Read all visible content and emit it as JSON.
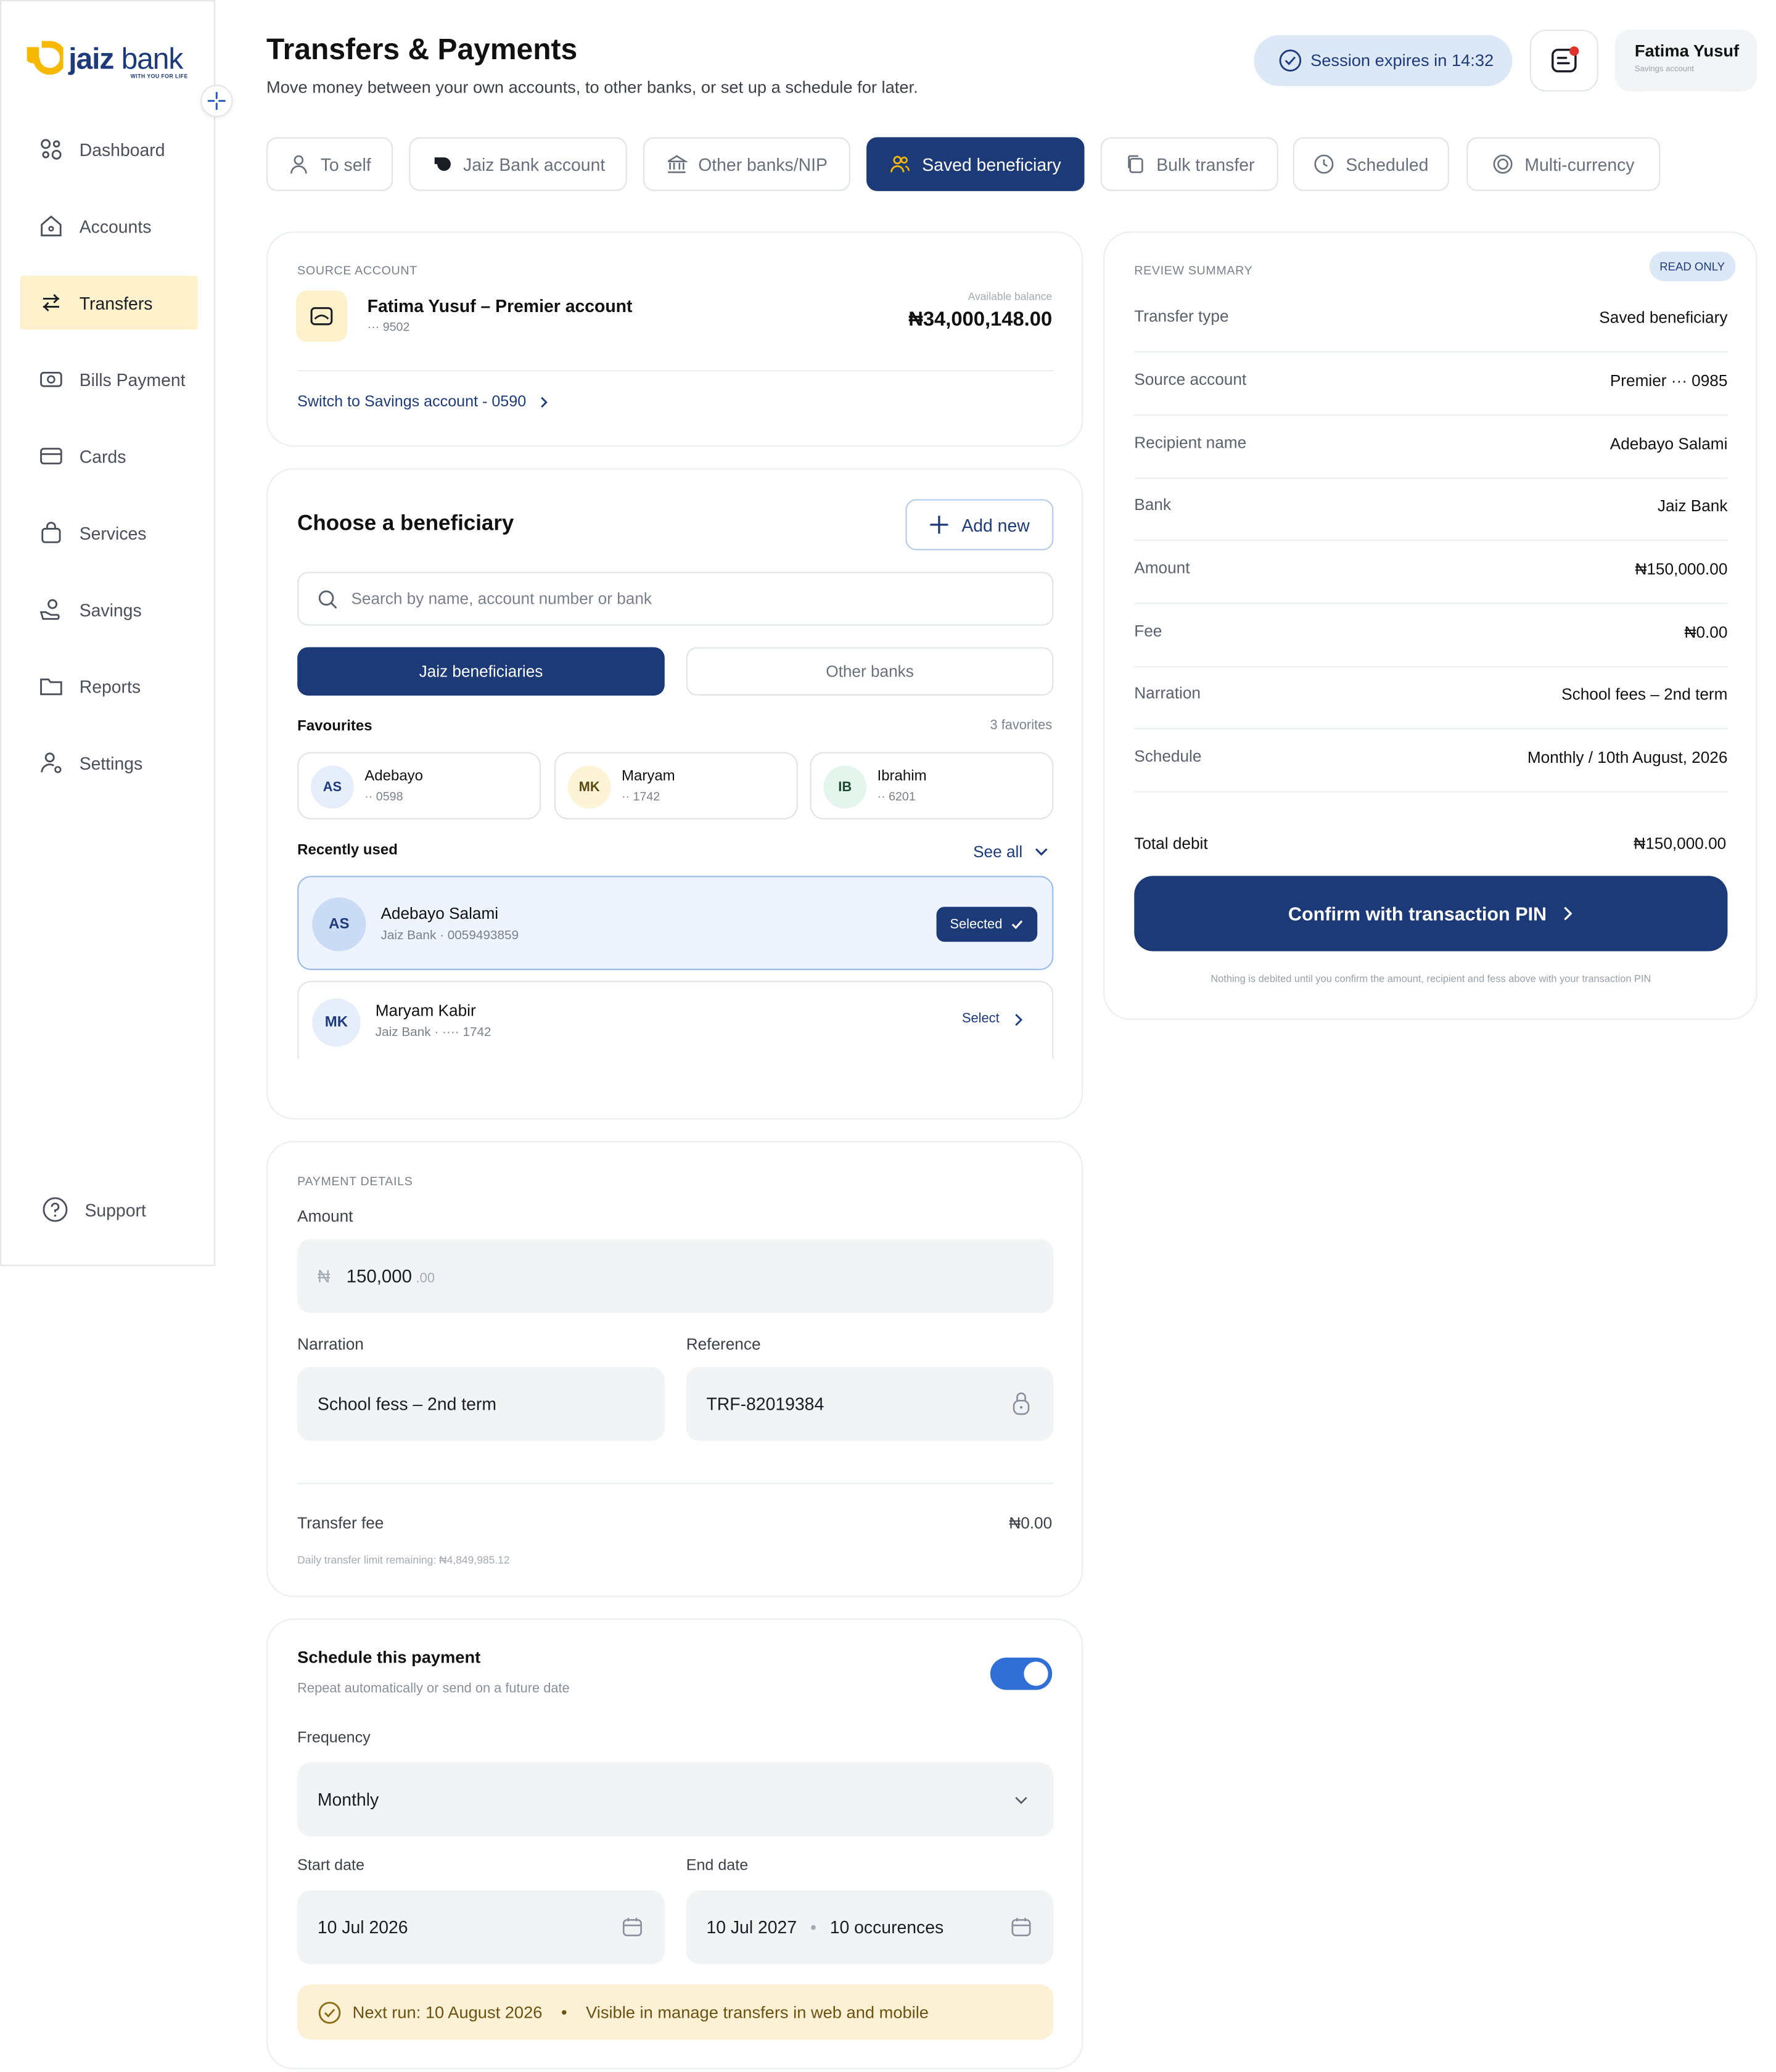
{
  "brand": {
    "name_main": "jaiz",
    "name_rest": "bank",
    "tagline": "WITH YOU FOR LIFE"
  },
  "sidebar": {
    "items": [
      {
        "label": "Dashboard",
        "icon": "dashboard-icon"
      },
      {
        "label": "Accounts",
        "icon": "home-icon"
      },
      {
        "label": "Transfers",
        "icon": "transfer-arrows-icon",
        "active": true
      },
      {
        "label": "Bills Payment",
        "icon": "bills-icon"
      },
      {
        "label": "Cards",
        "icon": "card-icon"
      },
      {
        "label": "Services",
        "icon": "bag-icon"
      },
      {
        "label": "Savings",
        "icon": "savings-icon"
      },
      {
        "label": "Reports",
        "icon": "folder-icon"
      },
      {
        "label": "Settings",
        "icon": "user-settings-icon"
      }
    ],
    "support": "Support"
  },
  "header": {
    "title": "Transfers & Payments",
    "subtitle": "Move money between your own accounts, to other banks, or set up a schedule for later.",
    "session": "Session expires in 14:32",
    "user_name": "Fatima Yusuf",
    "user_account": "Savings account"
  },
  "tabs": [
    {
      "label": "To self",
      "icon": "user-icon"
    },
    {
      "label": "Jaiz Bank account",
      "icon": "jaiz-logo-icon"
    },
    {
      "label": "Other banks/NIP",
      "icon": "bank-icon"
    },
    {
      "label": "Saved beneficiary",
      "icon": "users-icon",
      "active": true
    },
    {
      "label": "Bulk transfer",
      "icon": "copy-icon"
    },
    {
      "label": "Scheduled",
      "icon": "clock-icon"
    },
    {
      "label": "Multi-currency",
      "icon": "currency-icon"
    }
  ],
  "source": {
    "label": "SOURCE ACCOUNT",
    "account_name": "Fatima Yusuf – Premier account",
    "account_mask": "··· 9502",
    "balance_label": "Available balance",
    "balance": "₦34,000,148.00",
    "switch_link": "Switch to Savings account - 0590"
  },
  "beneficiary": {
    "title": "Choose a beneficiary",
    "add_new": "Add new",
    "search_placeholder": "Search by name, account number or bank",
    "seg_jaiz": "Jaiz beneficiaries",
    "seg_other": "Other banks",
    "favourites_label": "Favourites",
    "favourites_count": "3 favorites",
    "favourites": [
      {
        "initials": "AS",
        "name": "Adebayo",
        "acc": "·· 0598",
        "color": "#e6eefb"
      },
      {
        "initials": "MK",
        "name": "Maryam",
        "acc": "·· 1742",
        "color": "#fdf3d6"
      },
      {
        "initials": "IB",
        "name": "Ibrahim",
        "acc": "·· 6201",
        "color": "#e3f5ec"
      }
    ],
    "recent_label": "Recently used",
    "see_all": "See all",
    "recent": [
      {
        "initials": "AS",
        "name": "Adebayo Salami",
        "bank": "Jaiz Bank",
        "acc": "0059493859",
        "action": "Selected"
      },
      {
        "initials": "MK",
        "name": "Maryam Kabir",
        "bank": "Jaiz Bank",
        "acc": "···· 1742",
        "action": "Select"
      }
    ]
  },
  "payment": {
    "label": "PAYMENT DETAILS",
    "amount_label": "Amount",
    "currency_symbol": "₦",
    "amount_value": "150,000",
    "amount_decimal": ".00",
    "narration_label": "Narration",
    "narration_value": "School fess – 2nd term",
    "reference_label": "Reference",
    "reference_value": "TRF-82019384",
    "fee_label": "Transfer fee",
    "fee_value": "₦0.00",
    "limit_note": "Daily transfer limit remaining: ₦4,849,985.12"
  },
  "schedule": {
    "title": "Schedule this payment",
    "subtitle": "Repeat automatically or send on a future date",
    "enabled": true,
    "frequency_label": "Frequency",
    "frequency_value": "Monthly",
    "start_label": "Start date",
    "start_value": "10 Jul 2026",
    "end_label": "End date",
    "end_value": "10 Jul 2027",
    "end_occurrences": "10 occurences",
    "next_run": "Next run: 10 August 2026",
    "visibility": "Visible in manage transfers in web and mobile"
  },
  "summary": {
    "label": "REVIEW SUMMARY",
    "badge": "READ ONLY",
    "rows": [
      {
        "k": "Transfer type",
        "v": "Saved beneficiary"
      },
      {
        "k": "Source account",
        "v": "Premier ··· 0985"
      },
      {
        "k": "Recipient name",
        "v": "Adebayo Salami"
      },
      {
        "k": "Bank",
        "v": "Jaiz Bank"
      },
      {
        "k": "Amount",
        "v": "₦150,000.00"
      },
      {
        "k": "Fee",
        "v": "₦0.00"
      },
      {
        "k": "Narration",
        "v": "School fees – 2nd term"
      },
      {
        "k": "Schedule",
        "v": "Monthly / 10th August, 2026"
      }
    ],
    "total_label": "Total debit",
    "total_value": "₦150,000.00",
    "confirm_button": "Confirm with transaction PIN",
    "note": "Nothing is debited until you confirm the amount, recipient and fess above with your transaction PIN"
  },
  "colors": {
    "primary": "#1c3a78",
    "accent": "#f6b800",
    "active_nav": "#fdf1cc",
    "toggle": "#2f6fd6"
  }
}
